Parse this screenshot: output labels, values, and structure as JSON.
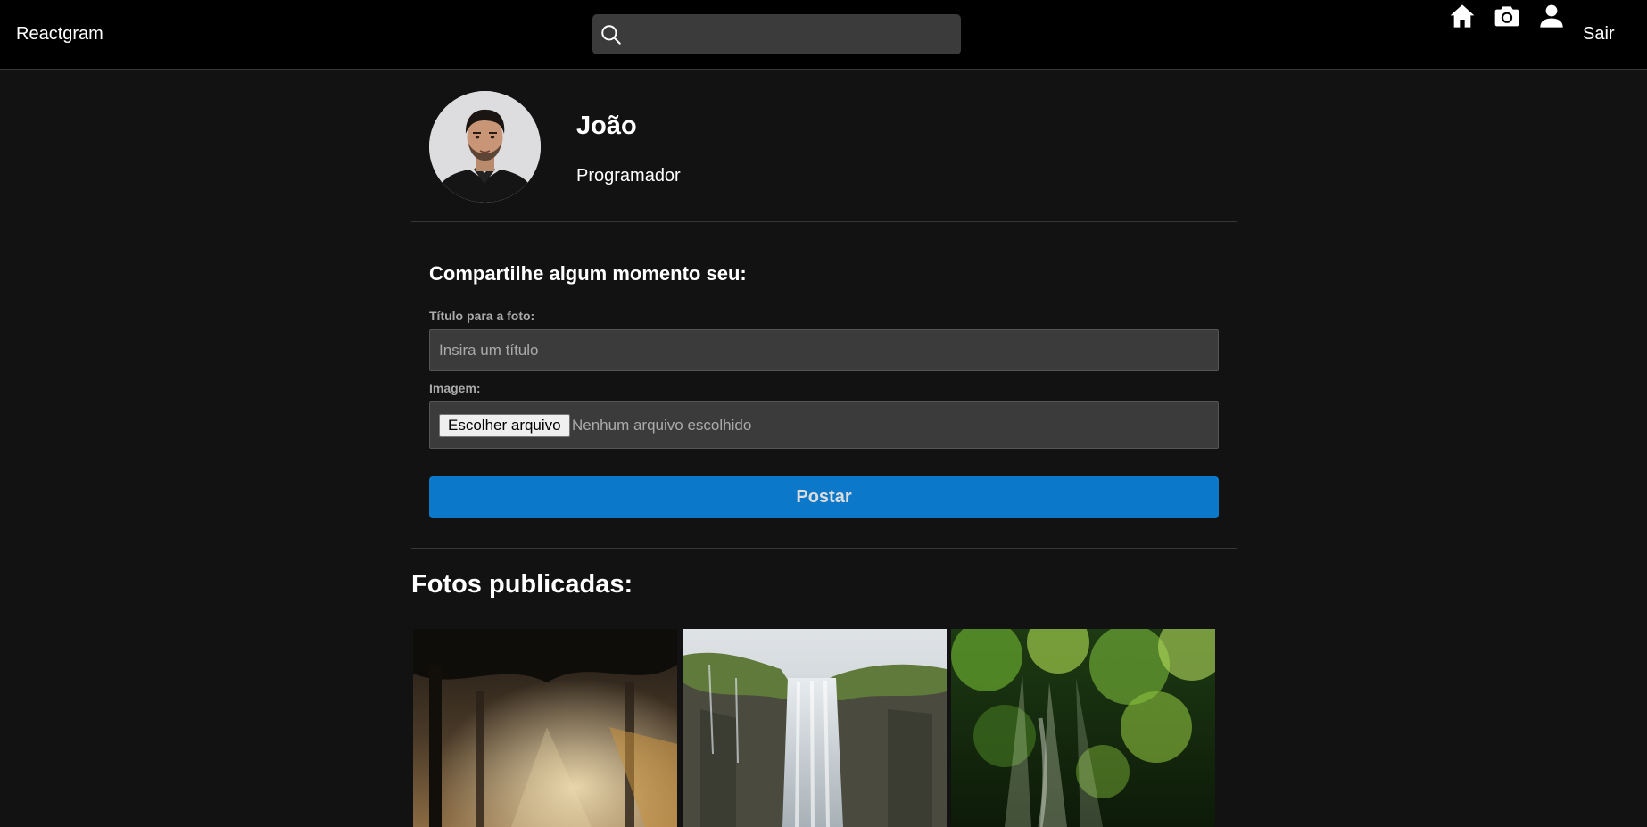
{
  "navbar": {
    "brand": "Reactgram",
    "search": {
      "placeholder": "",
      "value": ""
    },
    "icons": [
      "search-icon",
      "home-icon",
      "camera-icon",
      "user-icon"
    ],
    "logout_label": "Sair",
    "background": "#000000"
  },
  "profile": {
    "name": "João",
    "bio": "Programador"
  },
  "new_photo": {
    "heading": "Compartilhe algum momento seu:",
    "title_label": "Título para a foto:",
    "title_placeholder": "Insira um título",
    "title_value": "",
    "image_label": "Imagem:",
    "file_button_label": "Escolher arquivo",
    "file_status": "Nenhum arquivo escolhido",
    "submit_label": "Postar"
  },
  "photos": {
    "heading": "Fotos publicadas:",
    "items": [
      {
        "subject": "forest-sunlight"
      },
      {
        "subject": "waterfall-cliff"
      },
      {
        "subject": "jungle-sunrays"
      }
    ]
  },
  "colors": {
    "page_background": "#121212",
    "input_background": "#3b3b3b",
    "primary_button": "#0b78c9",
    "divider": "#363636"
  }
}
